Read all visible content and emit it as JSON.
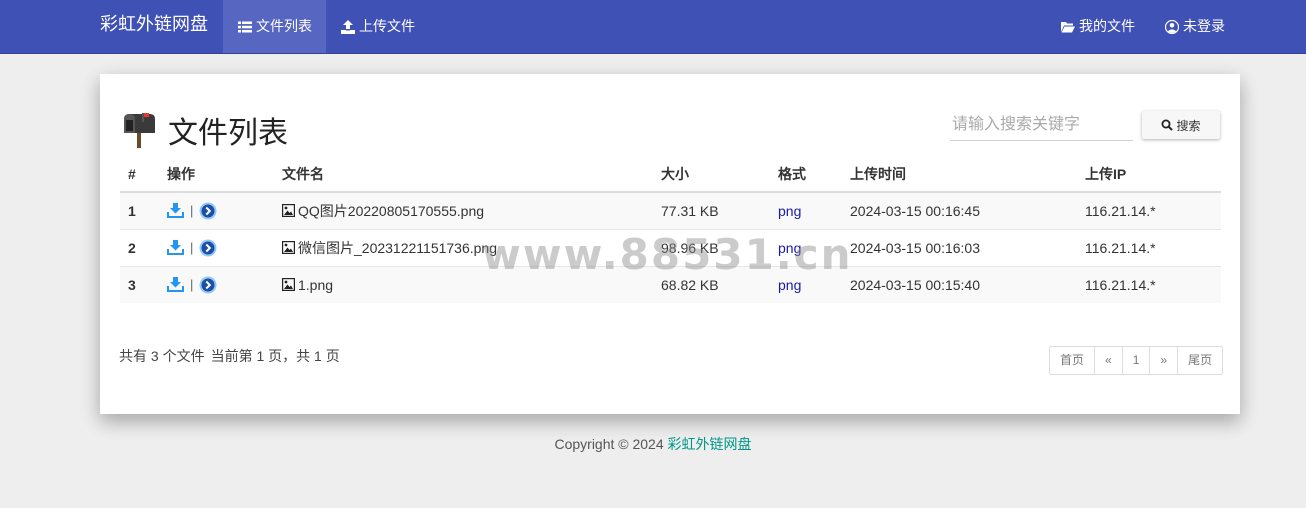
{
  "navbar": {
    "brand": "彩虹外链网盘",
    "items": [
      {
        "label": "文件列表",
        "icon": "list-icon",
        "active": true
      },
      {
        "label": "上传文件",
        "icon": "upload-icon",
        "active": false
      }
    ],
    "right_items": [
      {
        "label": "我的文件",
        "icon": "folder-open-icon"
      },
      {
        "label": "未登录",
        "icon": "user-circle-icon"
      }
    ]
  },
  "main": {
    "title": "文件列表",
    "title_icon": "mailbox-icon",
    "search": {
      "placeholder": "请输入搜索关键字",
      "value": "",
      "button_label": "搜索",
      "button_icon": "search-icon"
    },
    "table": {
      "columns": [
        "#",
        "操作",
        "文件名",
        "大小",
        "格式",
        "上传时间",
        "上传IP"
      ],
      "rows": [
        {
          "index": "1",
          "name": "QQ图片20220805170555.png",
          "size": "77.31 KB",
          "format": "png",
          "time": "2024-03-15 00:16:45",
          "ip": "116.21.14.*"
        },
        {
          "index": "2",
          "name": "微信图片_20231221151736.png",
          "size": "98.96 KB",
          "format": "png",
          "time": "2024-03-15 00:16:03",
          "ip": "116.21.14.*"
        },
        {
          "index": "3",
          "name": "1.png",
          "size": "68.82 KB",
          "format": "png",
          "time": "2024-03-15 00:15:40",
          "ip": "116.21.14.*"
        }
      ]
    },
    "summary": {
      "total": "共有 3 个文件",
      "page": "当前第 1 页，共 1 页"
    },
    "pagination": {
      "first": "首页",
      "prev": "«",
      "current": "1",
      "next": "»",
      "last": "尾页"
    }
  },
  "footer": {
    "copyright": "Copyright © 2024",
    "site_link": "彩虹外链网盘"
  },
  "watermark": "www.88531.cn",
  "colors": {
    "navbar": "#3f51b5",
    "nav_active": "#5767c1",
    "accent_link": "#009688",
    "download_icon": "#2196f3",
    "format_link": "#1a1aa6"
  }
}
